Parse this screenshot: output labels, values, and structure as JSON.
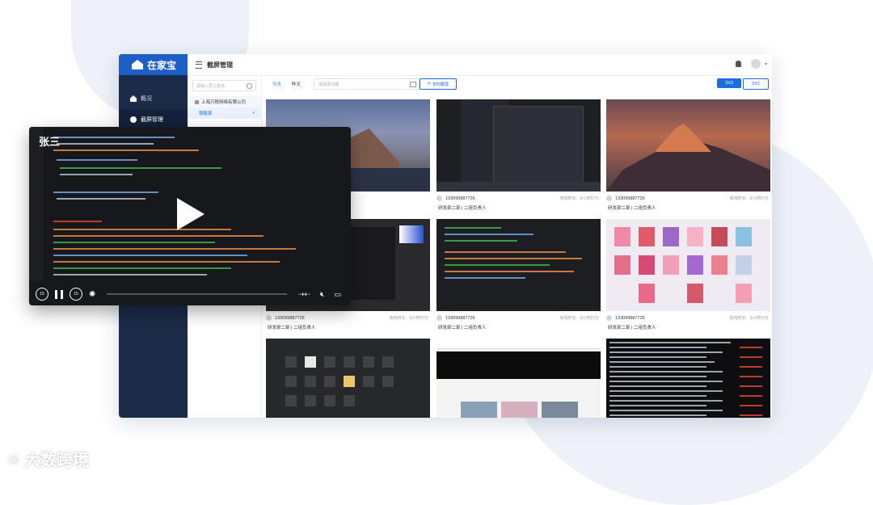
{
  "app": {
    "brand": "在家宝",
    "page_title": "截屏管理"
  },
  "sidebar": {
    "items": [
      {
        "label": "概况"
      },
      {
        "label": "截屏管理"
      }
    ]
  },
  "tree": {
    "search_placeholder": "请输入员工姓名",
    "org": "上海万税网络有限公司",
    "dept": "销售部"
  },
  "toolbar": {
    "tab_today": "今天",
    "tab_yesterday": "昨天",
    "date_placeholder": "请选择日期",
    "realtime_button": "实时截屏",
    "grid3": "3X3",
    "grid2": "2X2"
  },
  "cards": [
    {
      "phone": "",
      "time": "",
      "dept": ""
    },
    {
      "phone": "133099887726",
      "time": "有线时长：9小时57分",
      "dept": "研发部二部 | 二组负责人"
    },
    {
      "phone": "133099887726",
      "time": "有线时长：9小时57分",
      "dept": "研发部二部 | 二组负责人"
    },
    {
      "phone": "133099887726",
      "time": "有线时长：9小时57分",
      "dept": "研发部二部 | 二组负责人"
    },
    {
      "phone": "133099887726",
      "time": "有线时长：9小时57分",
      "dept": "研发部二部 | 二组负责人"
    },
    {
      "phone": "133099887726",
      "time": "有线时长：9小时57分",
      "dept": "研发部二部 | 二组负责人"
    }
  ],
  "player": {
    "user_name": "张三"
  },
  "watermark": "大数跨境",
  "colors": {
    "sidebar": "#1b2b48",
    "accent": "#1d6ce0",
    "player_bg": "#17181b"
  }
}
